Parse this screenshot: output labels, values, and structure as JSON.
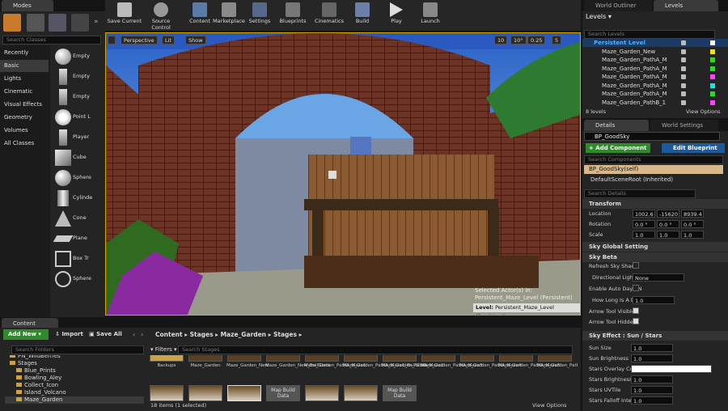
{
  "modes": {
    "tab": "Modes",
    "search_placeholder": "Search Classes",
    "categories": [
      "Recently Placed",
      "Basic",
      "Lights",
      "Cinematic",
      "Visual Effects",
      "Geometry",
      "Volumes",
      "All Classes"
    ],
    "items": [
      "Empty",
      "Empty",
      "Empty",
      "Point L",
      "Player",
      "Cube",
      "Sphere",
      "Cylinde",
      "Cone",
      "Plane",
      "Box Tr",
      "Sphere"
    ]
  },
  "toolbar": {
    "buttons": [
      "Save Current",
      "Source Control",
      "Content",
      "Marketplace",
      "Settings",
      "Blueprints",
      "Cinematics",
      "Build",
      "Play",
      "Launch"
    ],
    "accent": "#e8c000"
  },
  "viewport": {
    "perspective": "Perspective",
    "lit": "Lit",
    "show": "Show",
    "grid": "10",
    "angle": "10°",
    "scale": "0.25",
    "cam": "5",
    "selected_line1": "Selected Actor(s) in:",
    "selected_line2": "Persistent_Maze_Level (Persistent)",
    "level_label": "Level:",
    "level_value": "Persistent_Maze_Level (Persistent)"
  },
  "outliner": {
    "tab": "World Outliner",
    "tab2": "Levels",
    "levels_btn": "Levels",
    "search_placeholder": "Search Levels",
    "rows": [
      "Persistent Level",
      "Maze_Garden_New",
      "Maze_Garden_PathA_M",
      "Maze_Garden_PathA_M",
      "Maze_Garden_PathA_M",
      "Maze_Garden_PathA_M",
      "Maze_Garden_PathA_M",
      "Maze_Garden_PathB_1"
    ],
    "row_colors": [
      "#ffffff",
      "#e8e800",
      "#20e020",
      "#20e020",
      "#ff40ff",
      "#20e0e0",
      "#20e020",
      "#ff40ff"
    ],
    "count": "8 levels",
    "view_options": "View Options"
  },
  "details": {
    "tab": "Details",
    "tab2": "World Settings",
    "actor_name": "BP_GoodSky",
    "add_component": "+ Add Component",
    "edit_blueprint": "Edit Blueprint",
    "component_search": "Search Components",
    "self_row": "BP_GoodSky(self)",
    "root_row": "DefaultSceneRoot (Inherited)",
    "details_search": "Search Details",
    "transform": {
      "header": "Transform",
      "location": "Location",
      "rotation": "Rotation",
      "scale": "Scale",
      "loc": [
        "1002.6",
        "-15620",
        "8939.4"
      ],
      "rot": [
        "0.0 °",
        "0.0 °",
        "0.0 °"
      ],
      "scl": [
        "1.0",
        "1.0",
        "1.0"
      ]
    },
    "sky_global": "Sky Global Setting",
    "sky_beta": "Sky Beta",
    "props": [
      "Refresh Sky Shade",
      "Directional Light",
      "Enable Auto Day / N",
      "How Long Is A Da",
      "Arrow Tool  Visible",
      "Arrow Tool  Hidden"
    ],
    "dir_light_value": "None",
    "how_long_value": "1.0",
    "sky_effect": "Sky Effect : Sun / Stars",
    "effect_props": [
      "Sun Size",
      "Sun Brightness",
      "Stars Overlay  Col",
      "Stars Brightness",
      "Stars UVTile",
      "Stars Falloff Intens"
    ],
    "effect_values": [
      "1.0",
      "1.0",
      "",
      "1.0",
      "1.0",
      "1.0"
    ]
  },
  "content": {
    "tab": "Content Browser",
    "add_new": "Add New",
    "import": "Import",
    "save_all": "Save All",
    "path": [
      "Content",
      "Stages",
      "Maze_Garden",
      "Stages"
    ],
    "folder_search": "Search Folders",
    "filters": "Filters",
    "stage_search": "Search Stages",
    "tree": [
      "PN_WildBerries",
      "Stages",
      "Blue_Prints",
      "Bowling_Aley",
      "Collect_Icon",
      "Island_Volcano",
      "Maze_Garden"
    ],
    "assets_row1": [
      "Backups",
      "Maze_Garden",
      "Maze_Garden_New",
      "Maze_Garden_New_BuiltData",
      "Maze_Garden_PathA_Maze1",
      "Maze_Garden_PathA_Maze1_BuiltData",
      "Maze_Garden_PathA_Maze2",
      "Maze_Garden_PathA_Maze3",
      "Maze_Garden_PathA_Maze4",
      "Maze_Garden_PathA_Maze5",
      "Maze_Garden_PathA_Maze_Exit"
    ],
    "assets_row2": [
      "",
      "",
      "",
      "Map Build Data",
      "",
      "",
      "Map Build Data"
    ],
    "count": "18 items (1 selected)",
    "view_options": "View Options"
  }
}
